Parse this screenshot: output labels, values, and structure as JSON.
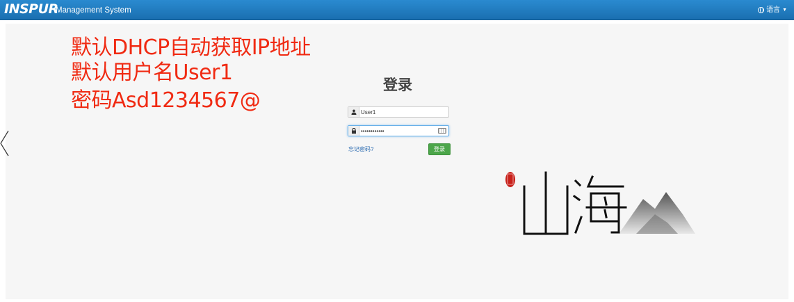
{
  "header": {
    "brand": "INSPUR",
    "title": "Management System",
    "language_label": "语言"
  },
  "annotation": {
    "line1": "默认DHCP自动获取IP地址",
    "line2": "默认用户名User1",
    "line3": "密码Asd1234567@"
  },
  "login": {
    "title": "登录",
    "username_value": "User1",
    "password_value": "••••••••••••",
    "forgot_password": "忘记密码?",
    "submit_label": "登录"
  },
  "logo": {
    "text": "山海"
  },
  "colors": {
    "topbar": "#1a6fb0",
    "annotation": "#f02a12",
    "login_button": "#4ca64a",
    "link": "#2a6ab0"
  },
  "icons": {
    "user": "user-icon",
    "lock": "lock-icon",
    "keyboard": "keyboard-icon",
    "globe": "globe-icon",
    "back": "chevron-left-icon"
  }
}
